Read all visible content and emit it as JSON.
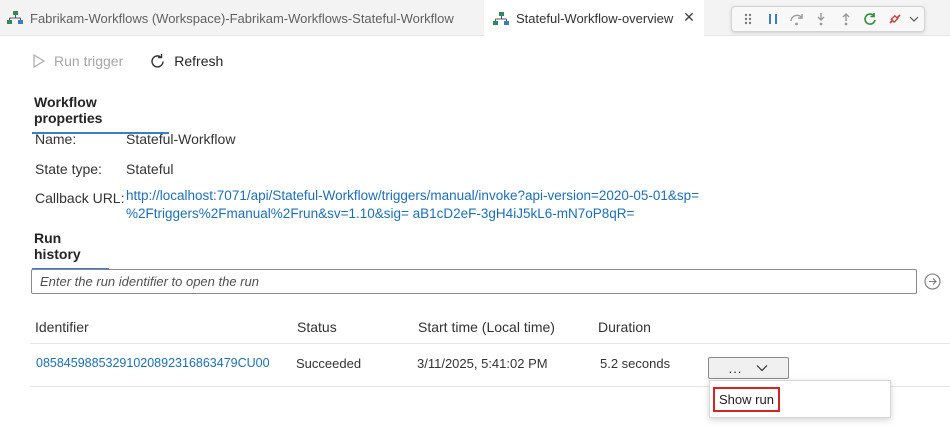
{
  "tabs": [
    {
      "label": "Fabrikam-Workflows (Workspace)-Fabrikam-Workflows-Stateful-Workflow",
      "icon": "workflow-icon",
      "active": false
    },
    {
      "label": "Stateful-Workflow-overview",
      "icon": "workflow-icon",
      "active": true
    }
  ],
  "debug_toolbar": {
    "icons": [
      "drag-handle-icon",
      "pause-icon",
      "step-over-icon",
      "step-into-icon",
      "step-out-icon",
      "restart-icon",
      "disconnect-icon",
      "chevron-down-icon"
    ]
  },
  "toolbar": {
    "run_trigger_label": "Run trigger",
    "refresh_label": "Refresh"
  },
  "properties": {
    "heading": "Workflow properties",
    "name_label": "Name:",
    "name_value": "Stateful-Workflow",
    "state_label": "State type:",
    "state_value": "Stateful",
    "callback_label": "Callback URL:",
    "callback_line1": "http://localhost:7071/api/Stateful-Workflow/triggers/manual/invoke?api-version=2020-05-01&sp=",
    "callback_line2": "%2Ftriggers%2Fmanual%2Frun&sv=1.10&sig= aB1cD2eF-3gH4iJ5kL6-mN7oP8qR="
  },
  "run_history": {
    "heading": "Run history",
    "search_placeholder": "Enter the run identifier to open the run",
    "columns": {
      "identifier": "Identifier",
      "status": "Status",
      "start_time": "Start time (Local time)",
      "duration": "Duration"
    },
    "rows": [
      {
        "identifier": "08584598853291020892316863479CU00",
        "status": "Succeeded",
        "start_time": "3/11/2025, 5:41:02 PM",
        "duration": "5.2 seconds"
      }
    ],
    "more_button_label": "...",
    "menu_items": [
      "Show run"
    ]
  },
  "colors": {
    "accent": "#3b7ec8",
    "link": "#1a6fbd",
    "highlight": "#d42424"
  }
}
